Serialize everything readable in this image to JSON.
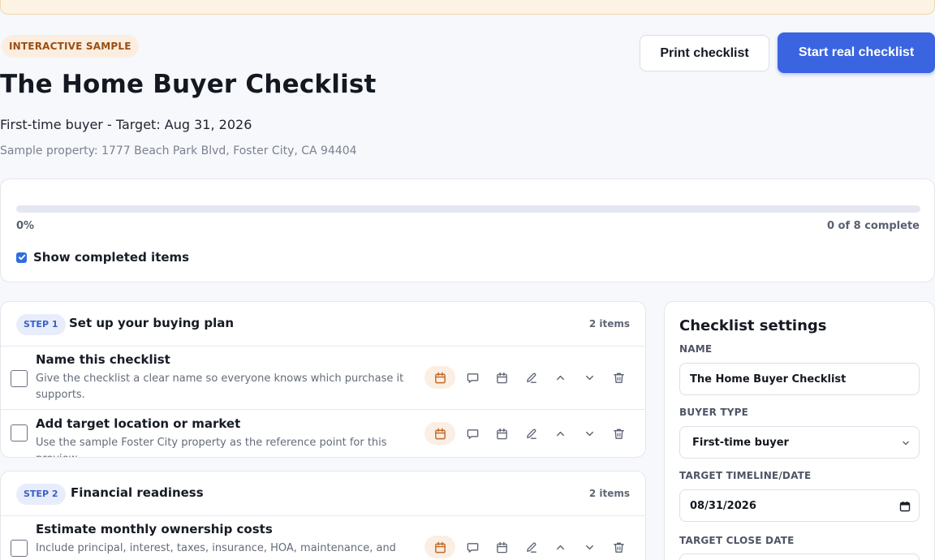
{
  "banner": {
    "text": ""
  },
  "header": {
    "badge": "INTERACTIVE SAMPLE",
    "title": "The Home Buyer Checklist",
    "subtitle": "First-time buyer - Target: Aug 31, 2026",
    "property": "Sample property: 1777 Beach Park Blvd, Foster City, CA 94404",
    "print_label": "Print checklist",
    "start_label": "Start real checklist"
  },
  "progress": {
    "value": 0,
    "percent_label": "0%",
    "complete_label": "0 of 8 complete",
    "show_completed_label": "Show completed items",
    "show_completed_checked": true
  },
  "steps": [
    {
      "pill": "STEP 1",
      "title": "Set up your buying plan",
      "count": "2 items",
      "tasks": [
        {
          "title": "Name this checklist",
          "desc": "Give the checklist a clear name so everyone knows which purchase it supports."
        },
        {
          "title": "Add target location or market",
          "desc": "Use the sample Foster City property as the reference point for this preview."
        }
      ]
    },
    {
      "pill": "STEP 2",
      "title": "Financial readiness",
      "count": "2 items",
      "tasks": [
        {
          "title": "Estimate monthly ownership costs",
          "desc": "Include principal, interest, taxes, insurance, HOA, maintenance, and"
        }
      ]
    }
  ],
  "task_action_icons": [
    "calendar-highlight-icon",
    "comment-icon",
    "calendar-icon",
    "edit-icon",
    "move-up-icon",
    "move-down-icon",
    "trash-icon"
  ],
  "settings": {
    "title": "Checklist settings",
    "name_label": "NAME",
    "name_value": "The Home Buyer Checklist",
    "buyer_type_label": "BUYER TYPE",
    "buyer_type_value": "First-time buyer",
    "timeline_label": "TARGET TIMELINE/DATE",
    "timeline_value": "08/31/2026",
    "close_date_label": "TARGET CLOSE DATE"
  },
  "colors": {
    "accent": "#3b65e0",
    "sample_badge": "#9a4f12",
    "step_pill": "#3b5fc8",
    "action_highlight": "#fbeee2"
  }
}
